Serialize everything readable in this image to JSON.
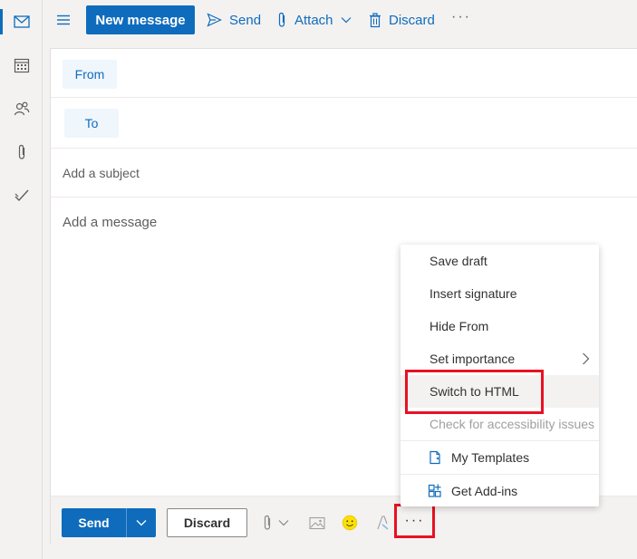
{
  "toolbar": {
    "new_message": "New message",
    "send": "Send",
    "attach": "Attach",
    "discard": "Discard",
    "more": "···"
  },
  "compose": {
    "from": "From",
    "to": "To",
    "subject_placeholder": "Add a subject",
    "message_placeholder": "Add a message"
  },
  "bottom": {
    "send": "Send",
    "discard": "Discard",
    "more": "···"
  },
  "menu": {
    "items": [
      {
        "label": "Save draft"
      },
      {
        "label": "Insert signature"
      },
      {
        "label": "Hide From"
      },
      {
        "label": "Set importance"
      },
      {
        "label": "Switch to HTML"
      },
      {
        "label": "Check for accessibility issues"
      },
      {
        "label": "My Templates"
      },
      {
        "label": "Get Add-ins"
      }
    ]
  },
  "colors": {
    "accent": "#0f6cbd",
    "highlight": "#e81123"
  },
  "icons": {
    "rail": [
      "mail-icon",
      "calendar-icon",
      "people-icon",
      "paperclip-icon",
      "todo-check-icon"
    ],
    "bottom": [
      "attach-icon",
      "image-icon",
      "emoji-icon",
      "format-painter-icon"
    ]
  }
}
